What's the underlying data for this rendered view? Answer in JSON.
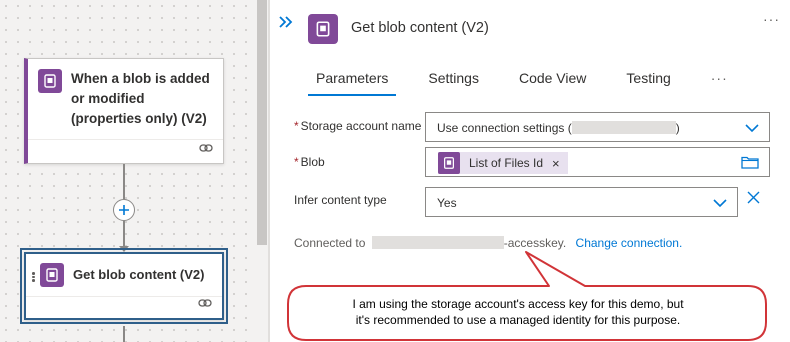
{
  "designer": {
    "trigger_card": {
      "title": "When a blob is added or modified (properties only) (V2)"
    },
    "action_card": {
      "title": "Get blob content (V2)"
    }
  },
  "panel": {
    "title": "Get blob content (V2)",
    "tabs": [
      {
        "label": "Parameters",
        "active": true
      },
      {
        "label": "Settings"
      },
      {
        "label": "Code View"
      },
      {
        "label": "Testing"
      }
    ],
    "more_glyph": "···",
    "tabs_more_glyph": "···",
    "fields": {
      "storage_account": {
        "required_marker": "*",
        "label": "Storage account name",
        "value_prefix": "Use connection settings (",
        "value_suffix": ")"
      },
      "blob": {
        "required_marker": "*",
        "label": "Blob",
        "token_label": "List of Files Id",
        "token_remove": "×"
      },
      "infer_content_type": {
        "label": "Infer content type",
        "value": "Yes"
      }
    },
    "connection": {
      "prefix": "Connected to",
      "suffix": "-accesskey.",
      "change_link": "Change connection."
    }
  },
  "callout": {
    "line1": "I am using the storage account's access key for this demo, but",
    "line2": "it's recommended to use a managed identity for this purpose."
  },
  "colors": {
    "accent": "#0078d4",
    "connector_purple": "#804998",
    "selected_border": "#2f5f8a",
    "callout_red": "#d13438"
  },
  "icons": {
    "expand": "double-chevron-right-icon",
    "connector": "azure-blob-storage-icon",
    "link": "link-icon",
    "dropdown": "chevron-down-icon",
    "file_picker": "folder-icon",
    "clear": "close-icon",
    "add_step": "plus-icon"
  }
}
